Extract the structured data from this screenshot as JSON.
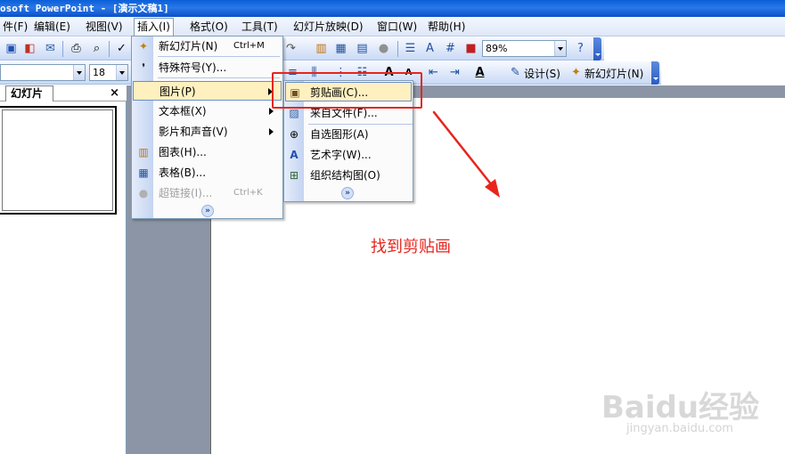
{
  "window": {
    "title": "osoft PowerPoint - [演示文稿1]"
  },
  "menubar": {
    "items": [
      {
        "label": "件(F)"
      },
      {
        "label": "编辑(E)"
      },
      {
        "label": "视图(V)"
      },
      {
        "label": "插入(I)"
      },
      {
        "label": "格式(O)"
      },
      {
        "label": "工具(T)"
      },
      {
        "label": "幻灯片放映(D)"
      },
      {
        "label": "窗口(W)"
      },
      {
        "label": "帮助(H)"
      }
    ]
  },
  "toolbar": {
    "zoom": "89%",
    "font_size": "18",
    "design_label": "设计(S)",
    "new_slide_label": "新幻灯片(N)"
  },
  "panel": {
    "tab_label": "幻灯片",
    "close": "×"
  },
  "insert_menu": {
    "items": [
      {
        "label": "新幻灯片(N)",
        "shortcut": "Ctrl+M"
      },
      {
        "label": "特殊符号(Y)..."
      },
      {
        "label": "图片(P)"
      },
      {
        "label": "文本框(X)"
      },
      {
        "label": "影片和声音(V)"
      },
      {
        "label": "图表(H)..."
      },
      {
        "label": "表格(B)..."
      },
      {
        "label": "超链接(I)...",
        "shortcut": "Ctrl+K"
      }
    ],
    "expand": "»"
  },
  "picture_submenu": {
    "items": [
      {
        "label": "剪贴画(C)..."
      },
      {
        "label": "来自文件(F)..."
      },
      {
        "label": "自选图形(A)"
      },
      {
        "label": "艺术字(W)..."
      },
      {
        "label": "组织结构图(O)"
      }
    ],
    "expand": "»"
  },
  "annotation": {
    "text": "找到剪贴画",
    "color": "#e8241c"
  },
  "watermark": {
    "brand": "Baidu经验",
    "url": "jingyan.baidu.com"
  }
}
